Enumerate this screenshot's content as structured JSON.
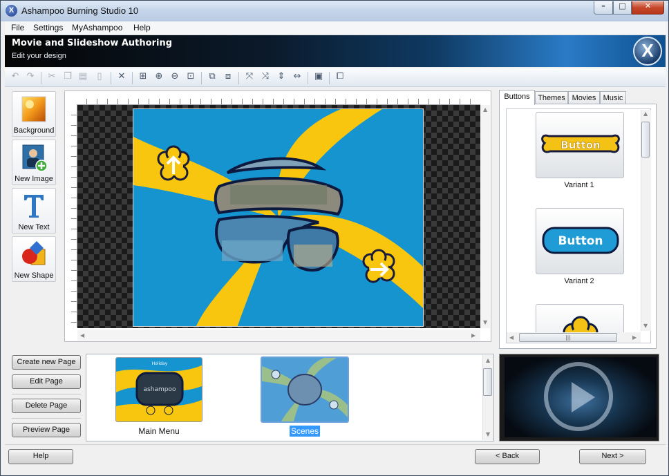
{
  "window": {
    "title": "Ashampoo Burning Studio 10",
    "logo_glyph": "X"
  },
  "controls": {
    "minimize": "–",
    "maximize": "□",
    "close": "✕"
  },
  "menu": [
    "File",
    "Settings",
    "MyAshampoo",
    "Help"
  ],
  "banner": {
    "title": "Movie and Slideshow Authoring",
    "subtitle": "Edit your design"
  },
  "toolbar_icons": [
    "undo-icon",
    "redo-icon",
    "cut-icon",
    "copy-icon",
    "paste-icon",
    "clipboard-icon",
    "delete-icon",
    "zoom-fit-icon",
    "zoom-in-icon",
    "zoom-out-icon",
    "zoom-area-icon",
    "bring-front-icon",
    "send-back-icon",
    "align-left-icon",
    "align-right-icon",
    "center-vertical-icon",
    "center-horizontal-icon",
    "properties-icon",
    "group-icon"
  ],
  "tools": [
    {
      "label": "Background",
      "icon": "background-icon"
    },
    {
      "label": "New Image",
      "icon": "new-image-icon"
    },
    {
      "label": "New Text",
      "icon": "new-text-icon"
    },
    {
      "label": "New Shape",
      "icon": "new-shape-icon"
    }
  ],
  "tabs": [
    "Buttons",
    "Themes",
    "Movies",
    "Music"
  ],
  "active_tab": "Buttons",
  "variants": [
    {
      "label": "Variant 1",
      "button_text": "Button",
      "color": "#f4c214"
    },
    {
      "label": "Variant 2",
      "button_text": "Button",
      "color": "#1f9bd6"
    }
  ],
  "page_actions": [
    "Create new Page",
    "Edit Page",
    "Delete Page",
    "Preview Page"
  ],
  "pages": [
    {
      "label": "Main Menu",
      "selected": false,
      "caption": "Holiday",
      "watermark": "ashampoo"
    },
    {
      "label": "Scenes",
      "selected": true
    }
  ],
  "footer": {
    "help": "Help",
    "back": "< Back",
    "next": "Next >"
  },
  "colors": {
    "swirl_blue": "#1594cf",
    "swirl_yellow": "#f8c60e",
    "selection": "#3399ff"
  }
}
